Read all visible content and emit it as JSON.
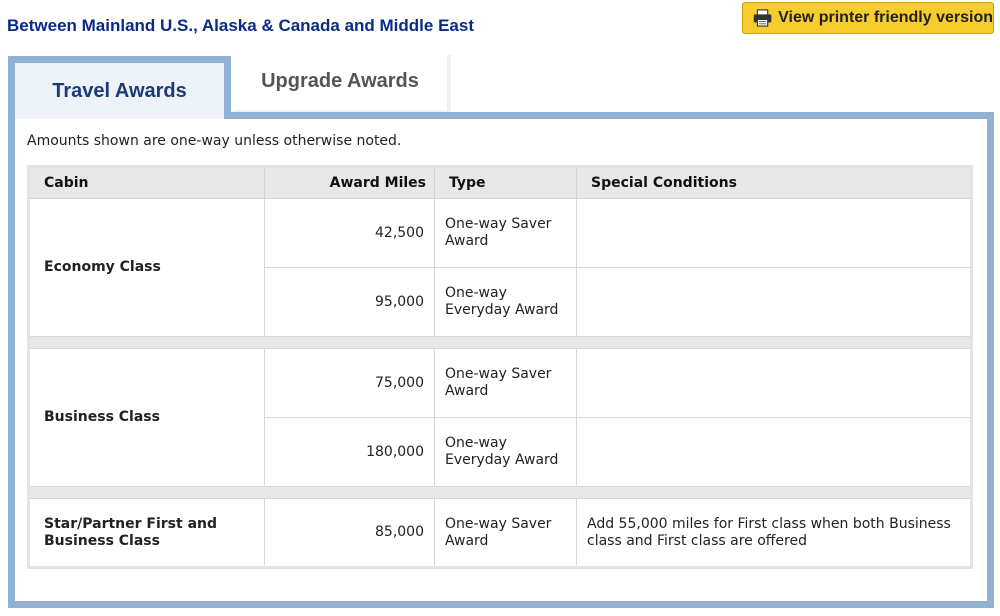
{
  "route_title": "Between Mainland U.S., Alaska & Canada and Middle East",
  "print_button": {
    "label": "View printer friendly version",
    "icon": "printer-icon"
  },
  "tabs": [
    {
      "label": "Travel Awards",
      "active": true
    },
    {
      "label": "Upgrade Awards",
      "active": false
    }
  ],
  "note": "Amounts shown are one-way unless otherwise noted.",
  "table": {
    "headers": {
      "cabin": "Cabin",
      "miles": "Award Miles",
      "type": "Type",
      "conditions": "Special Conditions"
    },
    "groups": [
      {
        "cabin": "Economy Class",
        "rows": [
          {
            "miles": "42,500",
            "type": "One-way Saver Award",
            "conditions": ""
          },
          {
            "miles": "95,000",
            "type": "One-way Everyday Award",
            "conditions": ""
          }
        ]
      },
      {
        "cabin": "Business Class",
        "rows": [
          {
            "miles": "75,000",
            "type": "One-way Saver Award",
            "conditions": ""
          },
          {
            "miles": "180,000",
            "type": "One-way Everyday Award",
            "conditions": ""
          }
        ]
      },
      {
        "cabin": "Star/Partner First and Business Class",
        "rows": [
          {
            "miles": "85,000",
            "type": "One-way Saver Award",
            "conditions": "Add 55,000 miles for First class when both Business class and First class are offered"
          }
        ]
      }
    ]
  },
  "colors": {
    "title_blue": "#0a2a8a",
    "button_yellow": "#f6cd2c",
    "panel_border": "#92b2d4"
  }
}
